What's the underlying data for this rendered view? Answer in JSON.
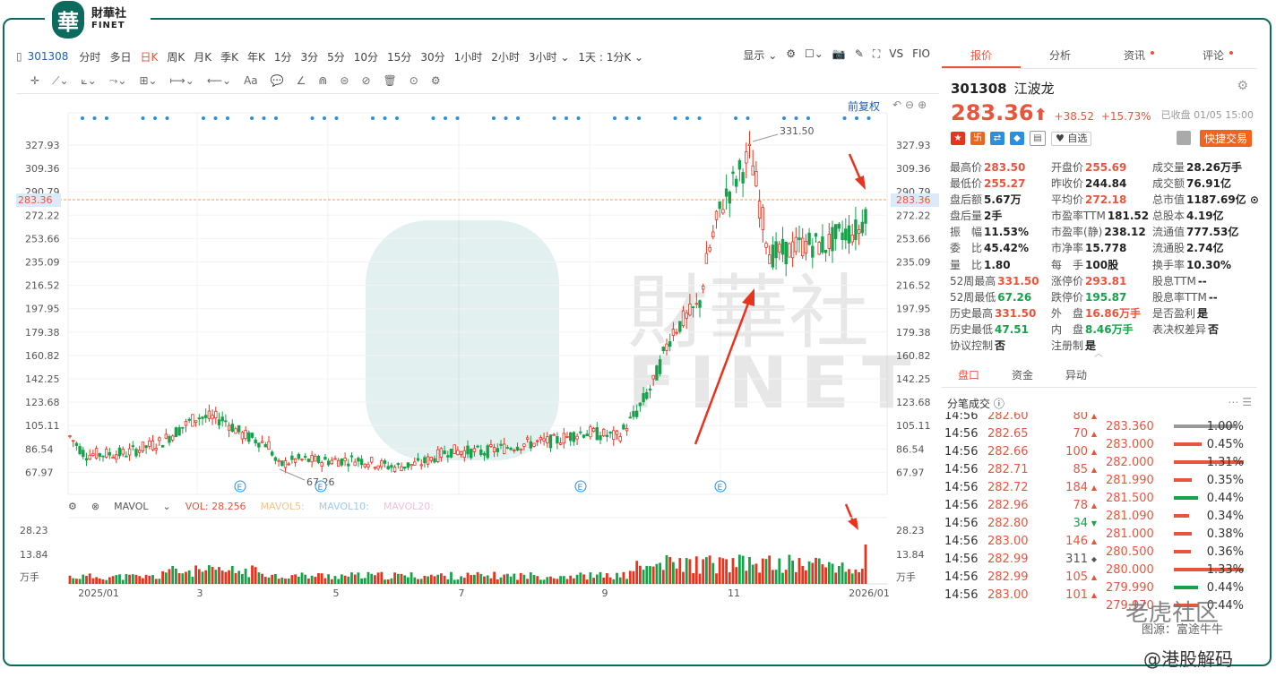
{
  "logo": {
    "mark": "華",
    "cn": "財華社",
    "en": "FINET"
  },
  "toolbar": {
    "code": "301308",
    "periods": [
      "分时",
      "多日",
      "日K",
      "周K",
      "月K",
      "季K",
      "年K",
      "1分",
      "3分",
      "5分",
      "10分",
      "15分",
      "30分",
      "1小时",
      "2小时",
      "3小时 ⌄",
      "1天 : 1分K ⌄"
    ],
    "active_period": "日K",
    "right": [
      "显示 ⌄",
      "⚙",
      "☐⌄",
      "📷",
      "✎",
      "⛶",
      "VS",
      "FIO"
    ]
  },
  "draw_tools": [
    "✛",
    "⟋⌄",
    "⟀⌄",
    "⤳⌄",
    "⊞⌄",
    "⟼⌄",
    "⟵⌄",
    "Aa",
    "💬",
    "∠",
    "⋒",
    "⊜",
    "⊘",
    "🗑",
    "⊙",
    "⚙"
  ],
  "chart": {
    "fq_label": "前复权",
    "y_ticks": [
      "327.93",
      "309.36",
      "290.79",
      "272.22",
      "253.66",
      "235.09",
      "216.52",
      "197.95",
      "179.38",
      "160.82",
      "142.25",
      "123.68",
      "105.11",
      "86.54",
      "67.97"
    ],
    "current_price_tag": "283.36",
    "high_label": "331.50",
    "low_label": "67.26",
    "x_labels": [
      "2025/01",
      "3",
      "5",
      "7",
      "9",
      "11",
      "2026/01"
    ],
    "event_marker": "E"
  },
  "volume": {
    "label": "MAVOL",
    "vol_text": "VOL: 28.256",
    "ma5": "MAVOL5:",
    "ma10": "MAVOL10:",
    "ma20": "MAVOL20:",
    "y_ticks": [
      "28.23",
      "13.84",
      "万手"
    ]
  },
  "panel": {
    "tabs": [
      {
        "label": "报价",
        "dot": false
      },
      {
        "label": "分析",
        "dot": false
      },
      {
        "label": "资讯",
        "dot": true
      },
      {
        "label": "评论",
        "dot": true
      }
    ],
    "code": "301308",
    "name": "江波龙",
    "price": "283.36",
    "arrow": "⬆",
    "change": "+38.52",
    "change_pct": "+15.73%",
    "status": "已收盘 01/05 15:00",
    "watch_label": "♥ 自选",
    "trade_label": "快捷交易",
    "quote_rows": [
      [
        [
          "最高价",
          "283.50",
          "red"
        ],
        [
          "开盘价",
          "255.69",
          "red"
        ],
        [
          "成交量",
          "28.26万手",
          ""
        ]
      ],
      [
        [
          "最低价",
          "255.27",
          "red"
        ],
        [
          "昨收价",
          "244.84",
          ""
        ],
        [
          "成交额",
          "76.91亿",
          ""
        ]
      ],
      [
        [
          "盘后额",
          "5.67万",
          ""
        ],
        [
          "平均价",
          "272.18",
          "red"
        ],
        [
          "总市值",
          "1187.69亿 ⊙",
          ""
        ]
      ],
      [
        [
          "盘后量",
          "2手",
          ""
        ],
        [
          "市盈率TTM",
          "181.52",
          ""
        ],
        [
          "总股本",
          "4.19亿",
          ""
        ]
      ],
      [
        [
          "振　幅",
          "11.53%",
          ""
        ],
        [
          "市盈率(静)",
          "238.12",
          ""
        ],
        [
          "流通值",
          "777.53亿",
          ""
        ]
      ],
      [
        [
          "委　比",
          "45.42%",
          ""
        ],
        [
          "市净率",
          "15.778",
          ""
        ],
        [
          "流通股",
          "2.74亿",
          ""
        ]
      ],
      [
        [
          "量　比",
          "1.80",
          ""
        ],
        [
          "每　手",
          "100股",
          ""
        ],
        [
          "换手率",
          "10.30%",
          ""
        ]
      ],
      [
        [
          "52周最高",
          "331.50",
          "red"
        ],
        [
          "涨停价",
          "293.81",
          "red"
        ],
        [
          "股息TTM",
          "--",
          ""
        ]
      ],
      [
        [
          "52周最低",
          "67.26",
          "green"
        ],
        [
          "跌停价",
          "195.87",
          "green"
        ],
        [
          "股息率TTM",
          "--",
          ""
        ]
      ],
      [
        [
          "历史最高",
          "331.50",
          "red"
        ],
        [
          "外　盘",
          "16.86万手",
          "red"
        ],
        [
          "是否盈利",
          "是",
          ""
        ]
      ],
      [
        [
          "历史最低",
          "47.51",
          "green"
        ],
        [
          "内　盘",
          "8.46万手",
          "green"
        ],
        [
          "表决权差异",
          "否",
          ""
        ]
      ],
      [
        [
          "协议控制",
          "否",
          ""
        ],
        [
          "注册制",
          "是",
          ""
        ],
        [
          "",
          "",
          " "
        ]
      ]
    ],
    "sub_tabs": [
      "盘口",
      "资金",
      "异动"
    ],
    "fb_title": "分笔成交 ⓘ",
    "fb_tools": "⋯  ☰",
    "ticks": [
      [
        "14:56",
        "282.60",
        "80",
        "▲",
        "r"
      ],
      [
        "14:56",
        "282.65",
        "70",
        "▲",
        "r"
      ],
      [
        "14:56",
        "282.66",
        "100",
        "▲",
        "r"
      ],
      [
        "14:56",
        "282.71",
        "85",
        "▲",
        "r"
      ],
      [
        "14:56",
        "282.72",
        "184",
        "▲",
        "r"
      ],
      [
        "14:56",
        "282.96",
        "78",
        "▲",
        "r"
      ],
      [
        "14:56",
        "282.80",
        "34",
        "▼",
        "g"
      ],
      [
        "14:56",
        "283.00",
        "146",
        "▲",
        "r"
      ],
      [
        "14:56",
        "282.99",
        "311",
        "◆",
        "n"
      ],
      [
        "14:56",
        "282.99",
        "105",
        "▲",
        "r"
      ],
      [
        "14:56",
        "283.00",
        "101",
        "▲",
        "r"
      ]
    ],
    "depth": [
      [
        "283.360",
        "1.00%",
        0.9,
        "#999"
      ],
      [
        "283.000",
        "0.45%",
        0.4,
        "#e8553d"
      ],
      [
        "282.000",
        "1.31%",
        1.0,
        "#e8553d"
      ],
      [
        "281.990",
        "0.35%",
        0.25,
        "#e8553d"
      ],
      [
        "281.500",
        "0.44%",
        0.35,
        "#17a24a"
      ],
      [
        "281.090",
        "0.34%",
        0.22,
        "#e8553d"
      ],
      [
        "281.000",
        "0.38%",
        0.26,
        "#e8553d"
      ],
      [
        "280.500",
        "0.36%",
        0.24,
        "#e8553d"
      ],
      [
        "280.000",
        "1.33%",
        1.0,
        "#e8553d"
      ],
      [
        "279.990",
        "0.44%",
        0.35,
        "#17a24a"
      ],
      [
        "279.970",
        "0.44%",
        0.35,
        "#e8553d"
      ]
    ]
  },
  "watermarks": {
    "community": "老虎社区",
    "source": "图源：富途牛牛",
    "author": "@港股解码"
  }
}
